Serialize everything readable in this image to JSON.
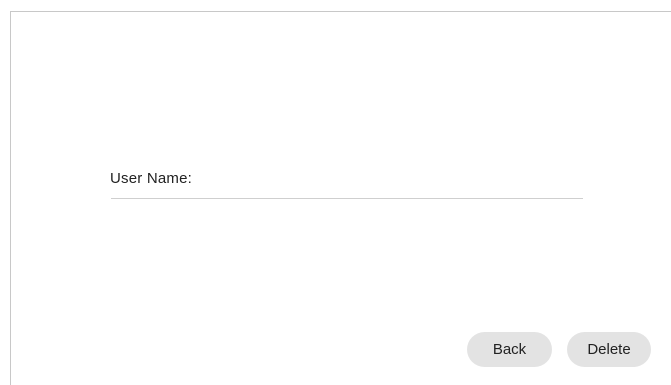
{
  "form": {
    "user_name_label": "User Name:",
    "user_name_value": "",
    "user_name_placeholder": ""
  },
  "actions": {
    "back_label": "Back",
    "delete_label": "Delete"
  },
  "colors": {
    "background": "#ffffff",
    "button_bg": "#e3e3e3",
    "text": "#222222",
    "divider": "#cfcfcf"
  }
}
